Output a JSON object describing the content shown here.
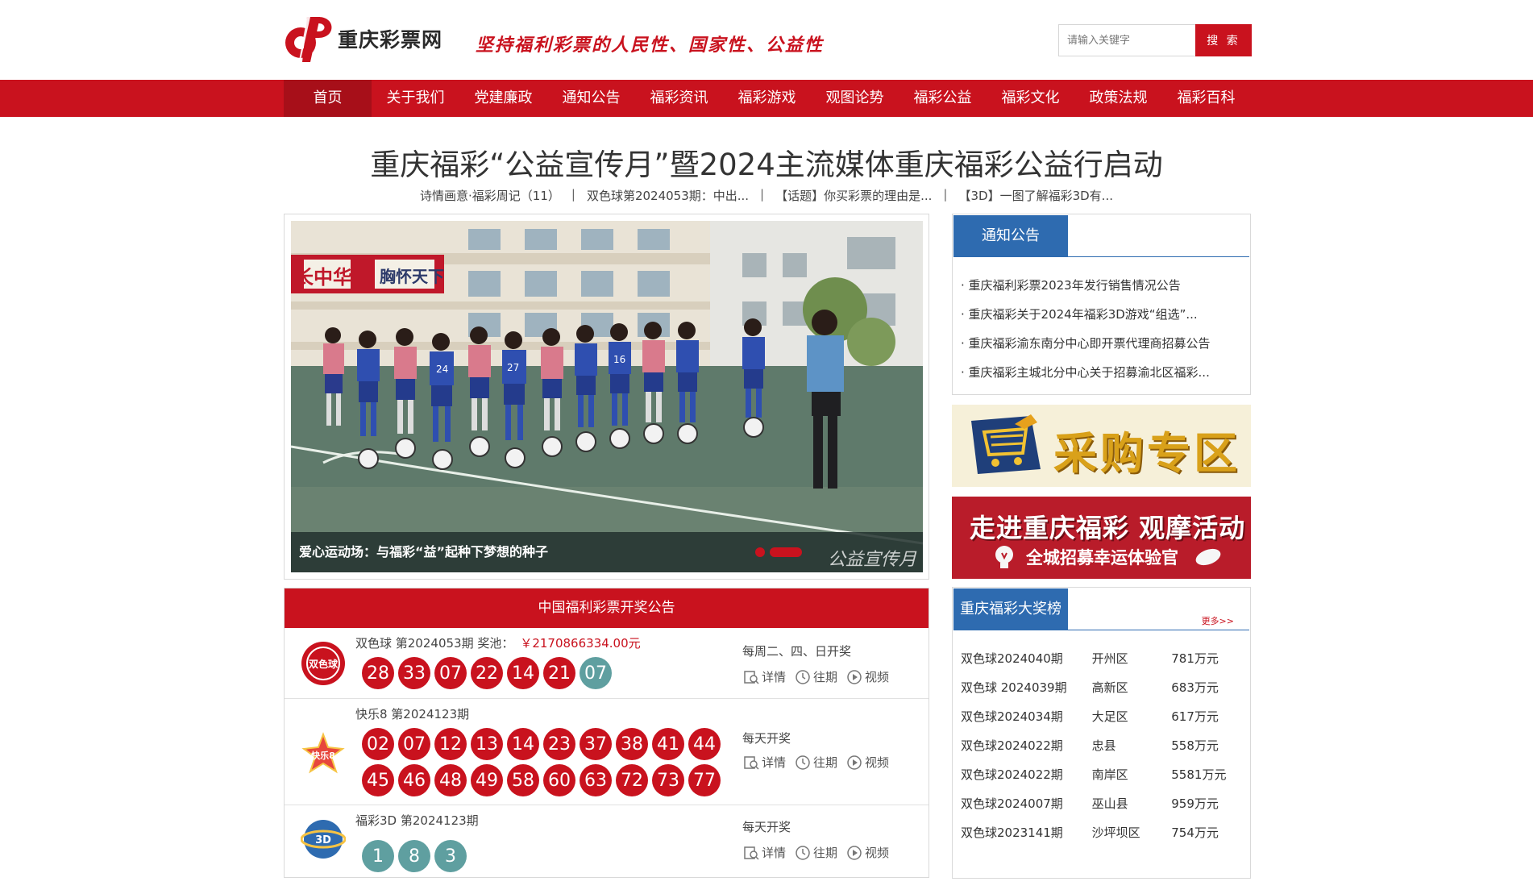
{
  "header": {
    "site_name": "重庆彩票网",
    "slogan": "坚持福利彩票的人民性、国家性、公益性",
    "search_placeholder": "请输入关键字",
    "search_button": "搜 索",
    "brand_color": "#c9121e"
  },
  "nav": {
    "items": [
      "首页",
      "关于我们",
      "党建廉政",
      "通知公告",
      "福彩资讯",
      "福彩游戏",
      "观图论势",
      "福彩公益",
      "福彩文化",
      "政策法规",
      "福彩百科"
    ],
    "active": "首页"
  },
  "headline": "重庆福彩“公益宣传月”暨2024主流媒体重庆福彩公益行启动",
  "ticker": [
    "诗情画意·福彩周记（11）",
    "双色球第2024053期：中出...",
    "【话题】你买彩票的理由是...",
    "【3D】一图了解福彩3D有..."
  ],
  "slider": {
    "caption": "爱心运动场：与福彩“益”起种下梦想的种子",
    "watermark": "公益宣传月",
    "scoreboard": [
      "长中华",
      "胸怀天下"
    ],
    "shirt_numbers": [
      "24",
      "27",
      "16"
    ]
  },
  "lottery": {
    "title": "中国福利彩票开奖公告",
    "link_labels": [
      "详情",
      "往期",
      "视频"
    ],
    "games": [
      {
        "name": "双色球 第2024053期 奖池：",
        "prize": "￥2170866334.00元",
        "schedule": "每周二、四、日开奖",
        "logo_text": "双色球",
        "red_balls": [
          "28",
          "33",
          "07",
          "22",
          "14",
          "21"
        ],
        "blue_balls": [
          "07"
        ]
      },
      {
        "name": "快乐8 第2024123期",
        "prize": "",
        "schedule": "每天开奖",
        "logo_text": "快乐8",
        "red_balls": [
          "02",
          "07",
          "12",
          "13",
          "14",
          "23",
          "37",
          "38",
          "41",
          "44",
          "45",
          "46",
          "48",
          "49",
          "58",
          "60",
          "63",
          "72",
          "73",
          "77"
        ],
        "blue_balls": []
      },
      {
        "name": "福彩3D 第2024123期",
        "prize": "",
        "schedule": "每天开奖",
        "logo_text": "3D",
        "red_balls": [],
        "blue_balls": [
          "1",
          "8",
          "3"
        ]
      }
    ]
  },
  "notice": {
    "tab": "通知公告",
    "items": [
      "· 重庆福利彩票2023年发行销售情况公告",
      "· 重庆福彩关于2024年福彩3D游戏“组选”...",
      "· 重庆福彩渝东南分中心即开票代理商招募公告",
      "· 重庆福彩主城北分中心关于招募渝北区福彩..."
    ]
  },
  "promo_buy": {
    "text": "采购专区"
  },
  "promo_visit": {
    "main": "走进重庆福彩 观摩活动",
    "sub": "全城招募幸运体验官"
  },
  "ranking": {
    "tab": "重庆福彩大奖榜",
    "more": "更多>>",
    "rows": [
      [
        "双色球2024040期",
        "开州区",
        "781万元"
      ],
      [
        "双色球 2024039期",
        "高新区",
        "683万元"
      ],
      [
        "双色球2024034期",
        "大足区",
        "617万元"
      ],
      [
        "双色球2024022期",
        "忠县",
        "558万元"
      ],
      [
        "双色球2024022期",
        "南岸区",
        "5581万元"
      ],
      [
        "双色球2024007期",
        "巫山县",
        "959万元"
      ],
      [
        "双色球2023141期",
        "沙坪坝区",
        "754万元"
      ]
    ]
  }
}
